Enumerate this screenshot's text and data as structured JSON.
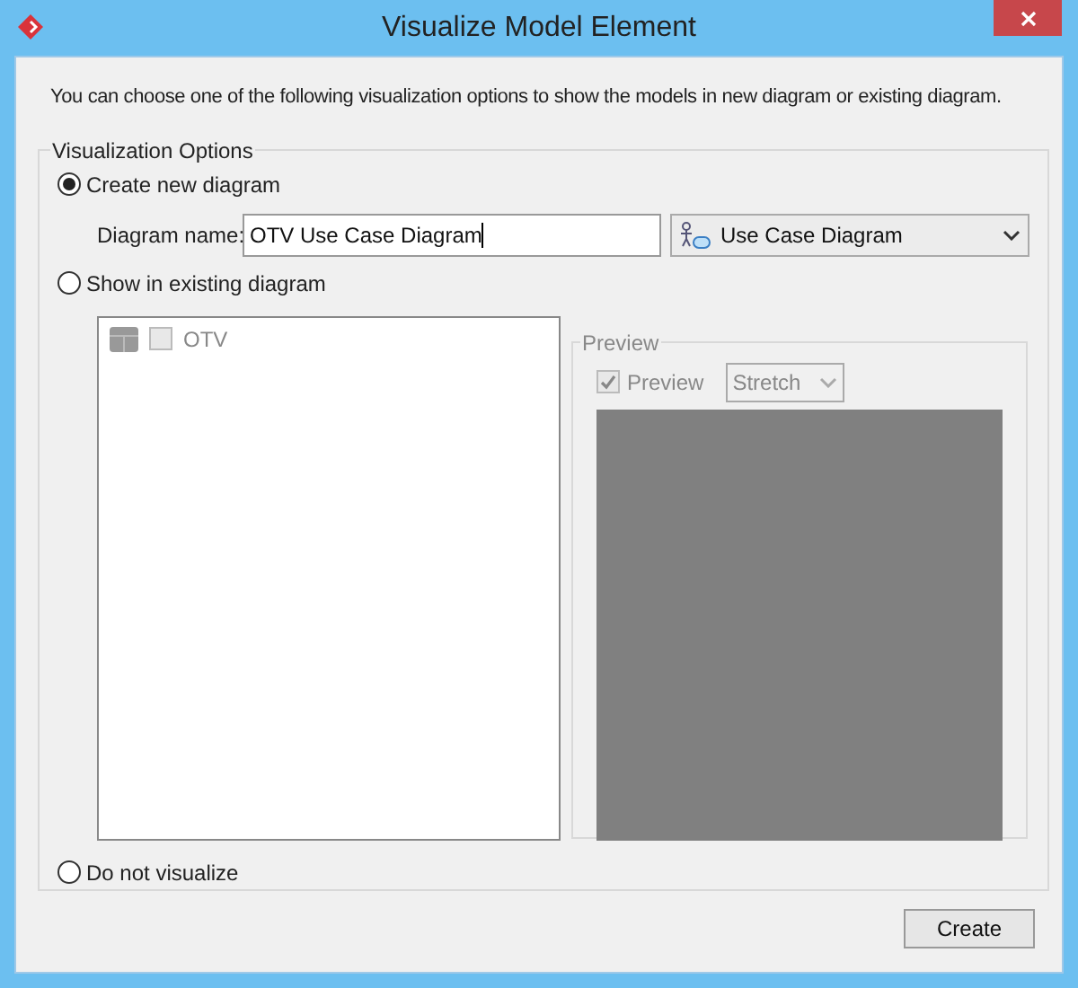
{
  "window": {
    "title": "Visualize Model Element"
  },
  "description": "You can choose one of the following visualization options to show the models in new diagram or existing diagram.",
  "options_group": {
    "legend": "Visualization Options"
  },
  "options": [
    {
      "kind": "new",
      "label": "Create new diagram",
      "selected": true,
      "name_label": "Diagram name:",
      "name_value": "OTV Use Case Diagram",
      "diagram_type": "Use Case Diagram"
    },
    {
      "kind": "existing",
      "label": "Show in existing diagram",
      "selected": false,
      "tree": [
        {
          "label": "OTV",
          "checked": false,
          "disabled": true
        }
      ],
      "preview": {
        "legend": "Preview",
        "checkbox_label": "Preview",
        "checked": true,
        "disabled": true,
        "scale": "Stretch"
      }
    },
    {
      "kind": "none",
      "label": "Do not visualize",
      "selected": false
    }
  ],
  "buttons": [
    {
      "label": "Create"
    }
  ]
}
